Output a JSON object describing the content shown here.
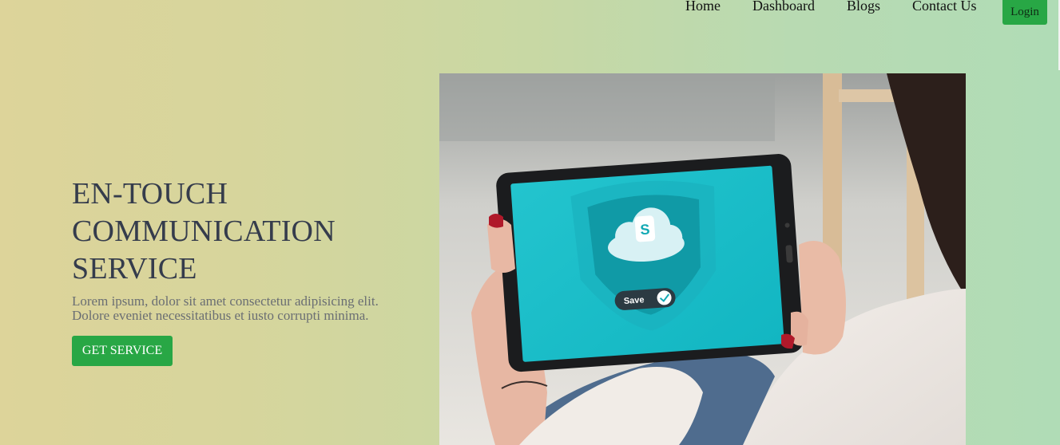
{
  "nav": {
    "items": [
      {
        "label": "Home"
      },
      {
        "label": "Dashboard"
      },
      {
        "label": "Blogs"
      },
      {
        "label": "Contact Us"
      }
    ],
    "login_label": "Login"
  },
  "hero": {
    "title_line1": "EN-TOUCH",
    "title_line2": "COMMUNICATION",
    "title_line3": "SERVICE",
    "description_line1": "Lorem ipsum, dolor sit amet consectetur adipisicing elit.",
    "description_line2": "Dolore eveniet necessitatibus et iusto corrupti minima.",
    "cta_label": "GET SERVICE"
  },
  "image": {
    "tablet_save_label": "Save",
    "app_logo_letter": "S"
  },
  "colors": {
    "accent_green": "#28a745",
    "title_color": "#353c4c",
    "screen_teal": "#1fc1cc"
  }
}
